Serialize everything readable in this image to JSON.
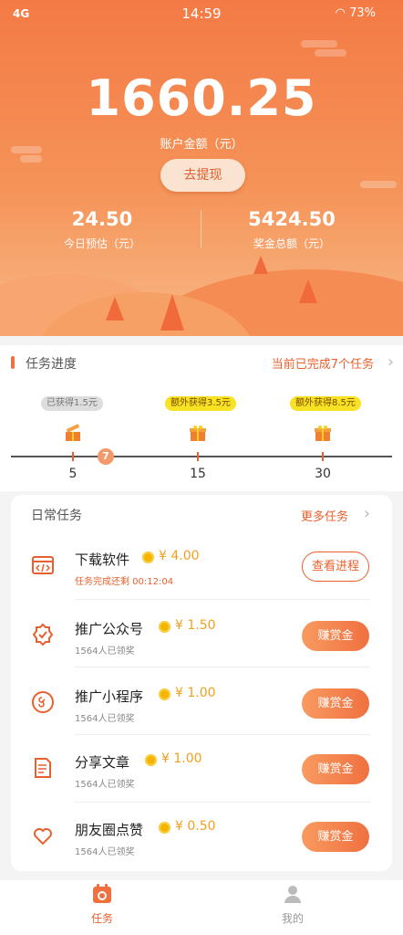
{
  "status_bar": {
    "signal": "4G",
    "time": "14:59",
    "battery": "73%"
  },
  "account": {
    "balance": "1660.25",
    "balance_label": "账户金额（元）",
    "withdraw_label": "去提现",
    "today_value": "24.50",
    "today_label": "今日预估（元）",
    "total_value": "5424.50",
    "total_label": "奖金总额（元）"
  },
  "progress": {
    "title": "任务进度",
    "completed_text": "当前已完成7个任务",
    "current": "7",
    "milestones": [
      {
        "bubble": "已获得1.5元",
        "count": "5"
      },
      {
        "bubble": "额外获得3.5元",
        "count": "15"
      },
      {
        "bubble": "额外获得8.5元",
        "count": "30"
      }
    ]
  },
  "daily": {
    "title": "日常任务",
    "more_label": "更多任务",
    "tasks": [
      {
        "name": "下载软件",
        "reward": "¥ 4.00",
        "sub": "任务完成还剩 00:12:04",
        "button": "查看进程",
        "icon": "code-window-icon"
      },
      {
        "name": "推广公众号",
        "reward": "¥ 1.50",
        "sub": "1564人已领奖",
        "button": "赚赏金",
        "icon": "verified-badge-icon"
      },
      {
        "name": "推广小程序",
        "reward": "¥ 1.00",
        "sub": "1564人已领奖",
        "button": "赚赏金",
        "icon": "mini-program-icon"
      },
      {
        "name": "分享文章",
        "reward": "¥ 1.00",
        "sub": "1564人已领奖",
        "button": "赚赏金",
        "icon": "document-icon"
      },
      {
        "name": "朋友圈点赞",
        "reward": "¥ 0.50",
        "sub": "1564人已领奖",
        "button": "赚赏金",
        "icon": "heart-icon"
      }
    ]
  },
  "tabbar": {
    "tasks_label": "任务",
    "mine_label": "我的"
  },
  "colors": {
    "accent": "#f07040",
    "gold": "#f5b400"
  }
}
